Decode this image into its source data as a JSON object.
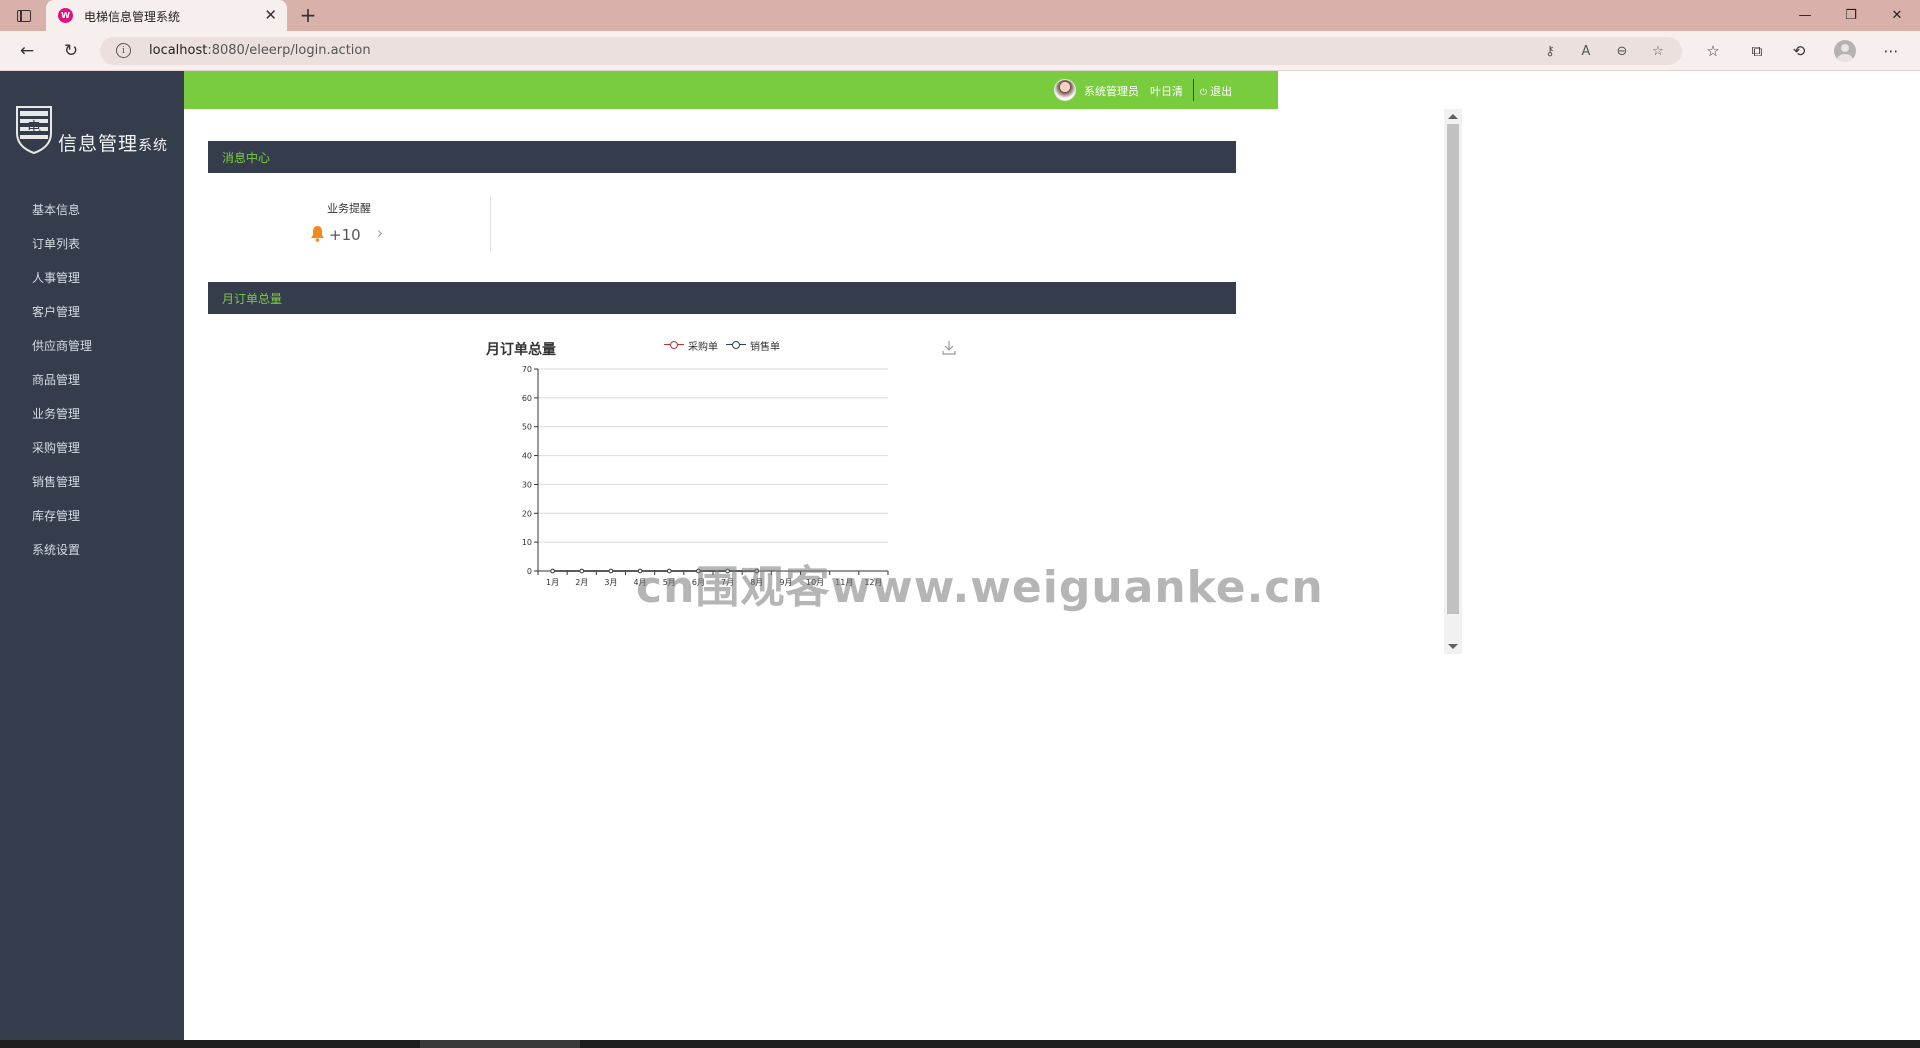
{
  "browser": {
    "tab_title": "电梯信息管理系统",
    "favicon_text": "W",
    "url_host": "localhost",
    "url_rest": ":8080/eleerp/login.action",
    "new_tab_label": "+"
  },
  "sidebar": {
    "logo_char": "电",
    "logo_text": "信息管理",
    "logo_text_small": "系统",
    "items": [
      {
        "label": "基本信息"
      },
      {
        "label": "订单列表"
      },
      {
        "label": "人事管理"
      },
      {
        "label": "客户管理"
      },
      {
        "label": "供应商管理"
      },
      {
        "label": "商品管理"
      },
      {
        "label": "业务管理"
      },
      {
        "label": "采购管理"
      },
      {
        "label": "销售管理"
      },
      {
        "label": "库存管理"
      },
      {
        "label": "系统设置"
      }
    ]
  },
  "topbar": {
    "role": "系统管理员",
    "username": "叶日清",
    "logout_label": "退出"
  },
  "sections": {
    "messages_title": "消息中心",
    "orders_title": "月订单总量"
  },
  "messages": {
    "label": "业务提醒",
    "count": "+10"
  },
  "chart_data": {
    "type": "line",
    "title": "月订单总量",
    "categories": [
      "1月",
      "2月",
      "3月",
      "4月",
      "5月",
      "6月",
      "7月",
      "8月",
      "9月",
      "10月",
      "11月",
      "12月"
    ],
    "series": [
      {
        "name": "采购单",
        "color": "#c23531",
        "values": [
          0,
          0,
          0,
          0,
          0,
          0,
          0,
          0
        ]
      },
      {
        "name": "销售单",
        "color": "#2f4554",
        "values": [
          0,
          0,
          0,
          0,
          0,
          0,
          0,
          0
        ]
      }
    ],
    "ylim": [
      0,
      70
    ],
    "yticks": [
      0,
      10,
      20,
      30,
      40,
      50,
      60,
      70
    ],
    "grid": true,
    "legend_position": "top"
  },
  "watermark": "cn围观客www.weiguanke.cn",
  "colors": {
    "sidebar_bg": "#353c4c",
    "topbar_bg": "#7acc3f",
    "section_title": "#7acc3f",
    "bell": "#f28b1e"
  }
}
